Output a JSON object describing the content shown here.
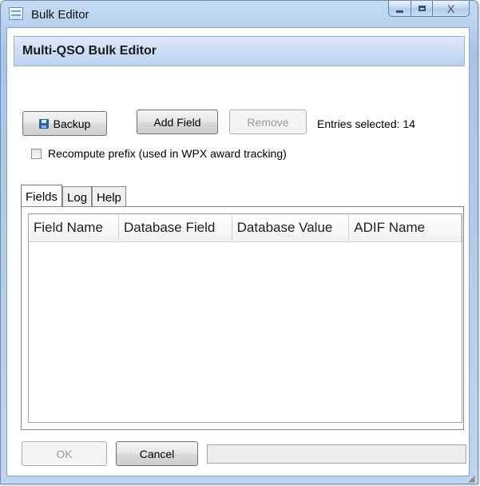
{
  "window": {
    "title": "Bulk Editor",
    "min_icon": "minimize-icon",
    "max_icon": "maximize-icon",
    "close_icon": "close-icon",
    "close_glyph": "X"
  },
  "header": {
    "title": "Multi-QSO Bulk Editor"
  },
  "toolbar": {
    "backup_label": "Backup",
    "backup_icon": "floppy-disk-icon",
    "add_field_label": "Add Field",
    "remove_label": "Remove",
    "entries_selected": "Entries selected: 14"
  },
  "options": {
    "recompute_prefix_label": "Recompute prefix (used in WPX award tracking)",
    "recompute_prefix_checked": false
  },
  "tabs": [
    {
      "label": "Fields",
      "active": true
    },
    {
      "label": "Log",
      "active": false
    },
    {
      "label": "Help",
      "active": false
    }
  ],
  "table": {
    "columns": [
      "Field Name",
      "Database Field",
      "Database Value",
      "ADIF Name"
    ],
    "rows": []
  },
  "footer": {
    "ok_label": "OK",
    "cancel_label": "Cancel"
  },
  "colors": {
    "accent": "#b9d1ef",
    "window_frame": "#a9c4e6"
  }
}
